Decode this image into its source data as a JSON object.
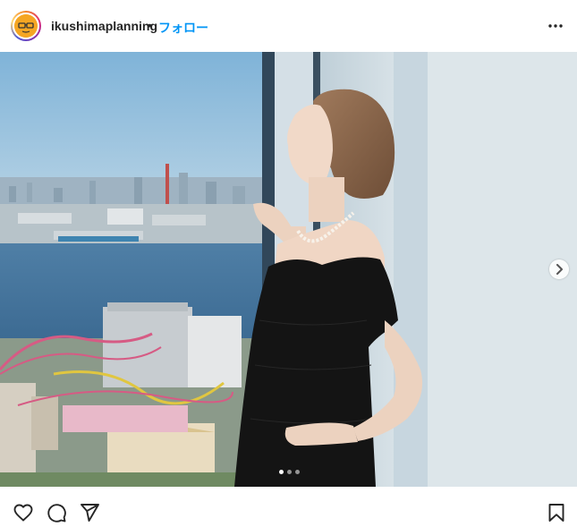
{
  "header": {
    "username": "ikushimaplanning",
    "separator": "•",
    "follow_label": "フォロー",
    "more_icon": "more-horizontal-icon",
    "avatar_icon": "avatar-glasses-icon"
  },
  "media": {
    "description_icon": "photo",
    "carousel": {
      "count": 3,
      "active_index": 0
    },
    "next_icon": "chevron-right-icon"
  },
  "actions": {
    "like_icon": "heart-icon",
    "comment_icon": "comment-icon",
    "share_icon": "send-icon",
    "save_icon": "bookmark-icon"
  },
  "colors": {
    "accent": "#0095f6",
    "text": "#262626",
    "avatar_bg": "#f5a623"
  }
}
